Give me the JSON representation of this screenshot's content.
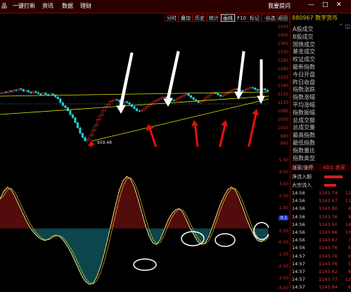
{
  "topbar": {
    "menus": [
      "品",
      "一键打新",
      "资讯",
      "数据",
      "理财"
    ],
    "ask": "我要提问",
    "window_controls": [
      "—",
      "□",
      "✕"
    ]
  },
  "toolbar": {
    "buttons": [
      "分时",
      "叠加",
      "历史",
      "统计",
      "画线",
      "F10",
      "标记",
      "-自选",
      "返回"
    ],
    "active": "画线"
  },
  "stock": {
    "code": "880967",
    "name": "数字货币"
  },
  "main_axis": [
    "1435",
    "1400",
    "1365",
    "1330",
    "1295",
    "1260",
    "1225",
    "1190",
    "1155",
    "1120",
    "1085",
    "1050",
    "1015",
    "980",
    "945"
  ],
  "ind_axis": [
    "5.50",
    "4.50",
    "3.50",
    "2.50",
    "1.50",
    "0.50",
    "-0.50",
    "-1.50",
    "-2.50",
    "-3.50",
    "-4.50"
  ],
  "ind_marker": "0.1",
  "low_label": "959.48",
  "chart_data": {
    "type": "candlestick",
    "title": "",
    "ylim": [
      945,
      1435
    ],
    "low": 959.48,
    "closes": [
      1158,
      1162,
      1160,
      1166,
      1163,
      1170,
      1168,
      1175,
      1172,
      1165,
      1168,
      1162,
      1158,
      1164,
      1160,
      1155,
      1150,
      1158,
      1152,
      1148,
      1155,
      1150,
      1142,
      1135,
      1120,
      1108,
      1100,
      1088,
      1072,
      1060,
      1040,
      1020,
      998,
      982,
      968,
      975,
      990,
      1010,
      1030,
      1052,
      1070,
      1088,
      1102,
      1112,
      1125,
      1128,
      1132,
      1130,
      1122,
      1118,
      1124,
      1120,
      1112,
      1104,
      1096,
      1088,
      1085,
      1090,
      1098,
      1105,
      1112,
      1118,
      1126,
      1130,
      1135,
      1140,
      1142,
      1138,
      1134,
      1130,
      1128,
      1135,
      1140,
      1145,
      1150,
      1155,
      1148,
      1140,
      1132,
      1126,
      1120,
      1126,
      1132,
      1140,
      1148,
      1155,
      1160,
      1156,
      1150,
      1145,
      1150,
      1155,
      1162,
      1168,
      1172,
      1175,
      1170,
      1168,
      1165,
      1172,
      1176,
      1180,
      1178,
      1172,
      1168,
      1172,
      1175,
      1170,
      1166
    ],
    "indicator_ylim": [
      -4.5,
      5.5
    ],
    "indicator": [
      2.2,
      2.8,
      3.1,
      2.9,
      2.4,
      1.8,
      1.2,
      0.6,
      0.1,
      -0.3,
      -0.6,
      -0.8,
      -0.9,
      -0.8,
      -0.6,
      -0.5,
      -0.6,
      -0.9,
      -1.3,
      -1.8,
      -2.4,
      -3.0,
      -3.6,
      -4.0,
      -4.2,
      -4.1,
      -3.6,
      -2.8,
      -1.8,
      -0.6,
      0.6,
      1.8,
      2.9,
      3.6,
      3.9,
      3.7,
      3.1,
      2.2,
      1.2,
      0.2,
      -0.6,
      -1.1,
      -1.2,
      -0.8,
      -0.1,
      0.6,
      1.1,
      1.4,
      1.5,
      1.2,
      0.6,
      0.0,
      -0.5,
      -1.0,
      -1.2,
      -1.1,
      -0.6,
      0.2,
      1.0,
      1.8,
      2.4,
      2.9,
      3.1,
      2.9,
      2.3,
      1.6,
      0.8,
      0.1,
      -0.5,
      -0.9,
      -1.0,
      -0.8,
      -0.4
    ]
  },
  "annotations": {
    "white_arrows": 5,
    "red_arrows": 6,
    "circles": 4
  },
  "market_items": [
    "A股成交",
    "B股成交",
    "国债成交",
    "基金成交",
    "权证成交",
    "最新指数",
    "今日开盘",
    "昨日收盘",
    "指数涨跌",
    "指数涨幅",
    "平均涨幅",
    "指数振幅",
    "总成交额",
    "总成交量",
    "最高指数",
    "最低指数",
    "指数量比",
    "指数类型"
  ],
  "flow": {
    "header_left": "涨家/涨停",
    "header_right": "40/1 跌家",
    "inflow_label": "净流入额",
    "inflow_pct": 0.7,
    "outflow_label": "大宗流入",
    "outflow_pct": 0.45
  },
  "ticks": [
    {
      "time": "14:56",
      "price": "1143.74",
      "vol": "12"
    },
    {
      "time": "14:56",
      "price": "1143.67",
      "vol": "11"
    },
    {
      "time": "14:56",
      "price": "1143.80",
      "vol": "8"
    },
    {
      "time": "14:56",
      "price": "1143.76",
      "vol": "9"
    },
    {
      "time": "14:56",
      "price": "1143.50",
      "vol": "14"
    },
    {
      "time": "14:56",
      "price": "1143.66",
      "vol": "10"
    },
    {
      "time": "14:56",
      "price": "1143.67",
      "vol": "7"
    },
    {
      "time": "14:56",
      "price": "1143.76",
      "vol": "6"
    },
    {
      "time": "14:57",
      "price": "1143.76",
      "vol": "9"
    },
    {
      "time": "14:57",
      "price": "1143.76",
      "vol": "5"
    },
    {
      "time": "14:57",
      "price": "1143.62",
      "vol": "8"
    },
    {
      "time": "14:57",
      "price": "1143.77",
      "vol": "12"
    },
    {
      "time": "14:57",
      "price": "1143.84",
      "vol": "6"
    }
  ]
}
